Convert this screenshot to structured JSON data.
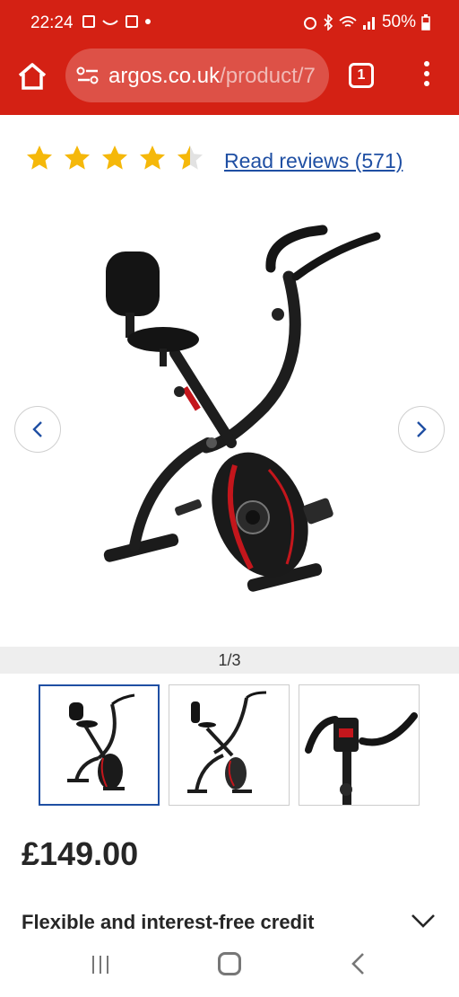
{
  "status_bar": {
    "time": "22:24",
    "battery": "50%"
  },
  "browser": {
    "url_host": "argos.co.uk",
    "url_path": "/product/7",
    "tab_count": "1"
  },
  "product": {
    "rating": 4.5,
    "reviews_link": "Read reviews (571)",
    "image_counter": "1/3",
    "price": "£149.00",
    "credit_label": "Flexible and interest-free credit"
  },
  "colors": {
    "brand_red": "#d42114",
    "star_gold": "#f5b80a",
    "link_blue": "#1f4fa3"
  }
}
